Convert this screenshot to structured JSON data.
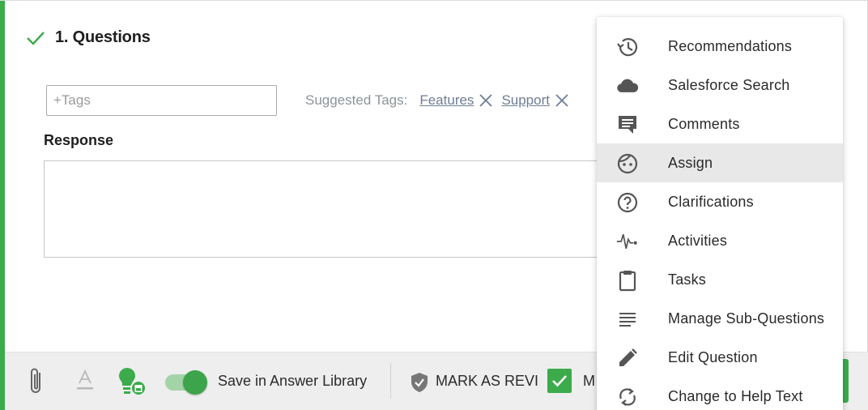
{
  "question": {
    "title": "1. Questions",
    "status_icon": "check-icon"
  },
  "tags": {
    "placeholder": "+Tags",
    "suggested_label": "Suggested Tags:",
    "suggested": [
      {
        "label": "Features",
        "icon": "close-icon"
      },
      {
        "label": "Support",
        "icon": "close-icon"
      }
    ]
  },
  "response": {
    "label": "Response",
    "value": ""
  },
  "toolbar": {
    "attach_icon": "paperclip-icon",
    "format_icon": "text-format-icon",
    "library_icon": "lightbulb-save-icon",
    "save_in_library_label": "Save in Answer Library",
    "save_in_library_on": true,
    "mark_reviewed_label": "MARK AS REVI",
    "mark_reviewed_icon": "shield-check-icon",
    "checkbox_label": "M",
    "checkbox_checked": true
  },
  "menu": {
    "items": [
      {
        "label": "Recommendations",
        "icon": "history-icon"
      },
      {
        "label": "Salesforce Search",
        "icon": "cloud-icon"
      },
      {
        "label": "Comments",
        "icon": "comment-icon"
      },
      {
        "label": "Assign",
        "icon": "face-icon",
        "active": true
      },
      {
        "label": "Clarifications",
        "icon": "help-circle-icon"
      },
      {
        "label": "Activities",
        "icon": "pulse-icon"
      },
      {
        "label": "Tasks",
        "icon": "clipboard-icon"
      },
      {
        "label": "Manage Sub-Questions",
        "icon": "lines-icon"
      },
      {
        "label": "Edit Question",
        "icon": "pencil-icon"
      },
      {
        "label": "Change to Help Text",
        "icon": "sync-icon"
      }
    ]
  },
  "colors": {
    "accent": "#3cab4c",
    "tag_link": "#6e7e94",
    "menu_active": "#e8e8e8"
  }
}
